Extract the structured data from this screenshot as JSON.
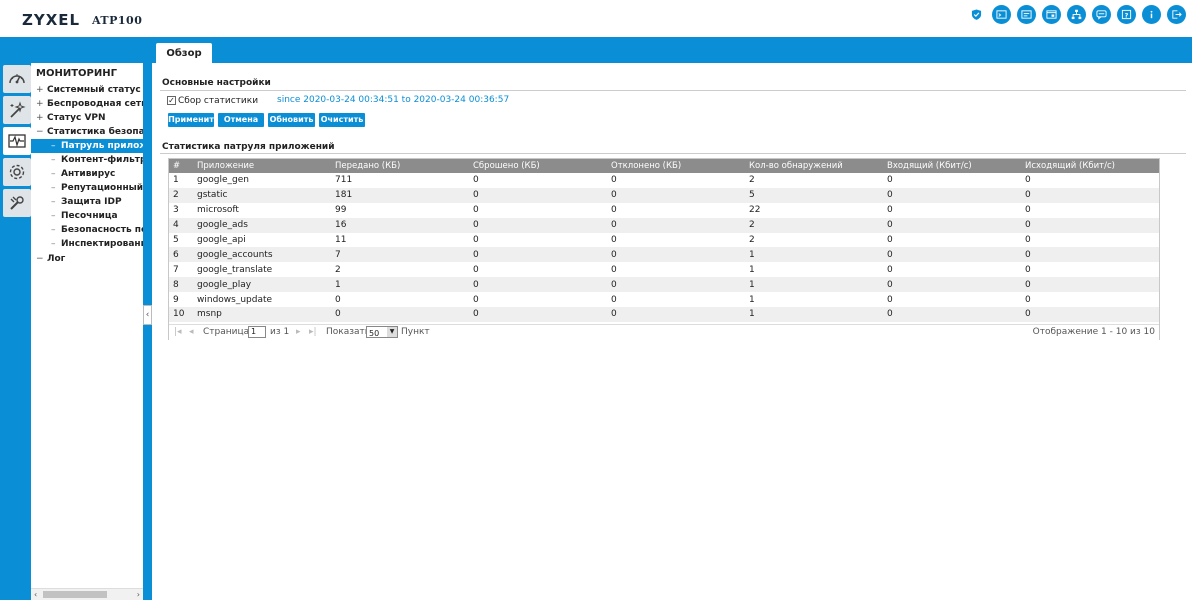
{
  "header": {
    "brand": "ZYXEL",
    "model": "ATP100",
    "icons": [
      "shield-icon",
      "console-icon",
      "cli-icon",
      "window-icon",
      "network-icon",
      "chat-icon",
      "help-box-icon",
      "info-icon",
      "logout-icon"
    ]
  },
  "tabs": {
    "active": "Обзор"
  },
  "sidebar": {
    "title": "МОНИТОРИНГ",
    "rail": [
      "dashboard-icon",
      "wizard-icon",
      "monitor-icon",
      "settings-icon",
      "maintenance-icon"
    ],
    "items": [
      {
        "label": "Системный статус",
        "prefix": "+"
      },
      {
        "label": "Беспроводная сеть",
        "prefix": "+"
      },
      {
        "label": "Статус VPN",
        "prefix": "+"
      },
      {
        "label": "Статистика безопасности",
        "prefix": "−"
      }
    ],
    "subitems": [
      {
        "label": "Патруль приложений",
        "active": true
      },
      {
        "label": "Контент-фильтр"
      },
      {
        "label": "Антивирус"
      },
      {
        "label": "Репутационный фильтр"
      },
      {
        "label": "Защита IDP"
      },
      {
        "label": "Песочница"
      },
      {
        "label": "Безопасность почты"
      },
      {
        "label": "Инспектирование SSL"
      }
    ],
    "log": {
      "label": "Лог",
      "prefix": "−"
    }
  },
  "basic": {
    "title": "Основные настройки",
    "checkbox_label": "Сбор статистики",
    "checked": true,
    "since": "since 2020-03-24 00:34:51 to 2020-03-24 00:36:57",
    "buttons": {
      "apply": "Применит",
      "cancel": "Отмена",
      "refresh": "Обновить",
      "clear": "Очистить"
    }
  },
  "stats": {
    "title": "Статистика патруля приложений",
    "columns": [
      "#",
      "Приложение",
      "Передано (КБ)",
      "Сброшено (КБ)",
      "Отклонено (КБ)",
      "Кол-во обнаружений",
      "Входящий (Кбит/с)",
      "Исходящий (Кбит/с)"
    ],
    "rows": [
      [
        "1",
        "google_gen",
        "711",
        "0",
        "0",
        "2",
        "0",
        "0"
      ],
      [
        "2",
        "gstatic",
        "181",
        "0",
        "0",
        "5",
        "0",
        "0"
      ],
      [
        "3",
        "microsoft",
        "99",
        "0",
        "0",
        "22",
        "0",
        "0"
      ],
      [
        "4",
        "google_ads",
        "16",
        "0",
        "0",
        "2",
        "0",
        "0"
      ],
      [
        "5",
        "google_api",
        "11",
        "0",
        "0",
        "2",
        "0",
        "0"
      ],
      [
        "6",
        "google_accounts",
        "7",
        "0",
        "0",
        "1",
        "0",
        "0"
      ],
      [
        "7",
        "google_translate",
        "2",
        "0",
        "0",
        "1",
        "0",
        "0"
      ],
      [
        "8",
        "google_play",
        "1",
        "0",
        "0",
        "1",
        "0",
        "0"
      ],
      [
        "9",
        "windows_update",
        "0",
        "0",
        "0",
        "1",
        "0",
        "0"
      ],
      [
        "10",
        "msnp",
        "0",
        "0",
        "0",
        "1",
        "0",
        "0"
      ]
    ],
    "pager": {
      "page_label": "Страница",
      "page": "1",
      "of_label": "из 1",
      "show_label": "Показать",
      "per_page": "50",
      "unit_label": "Пункт",
      "display": "Отображение 1 - 10 из 10"
    }
  }
}
